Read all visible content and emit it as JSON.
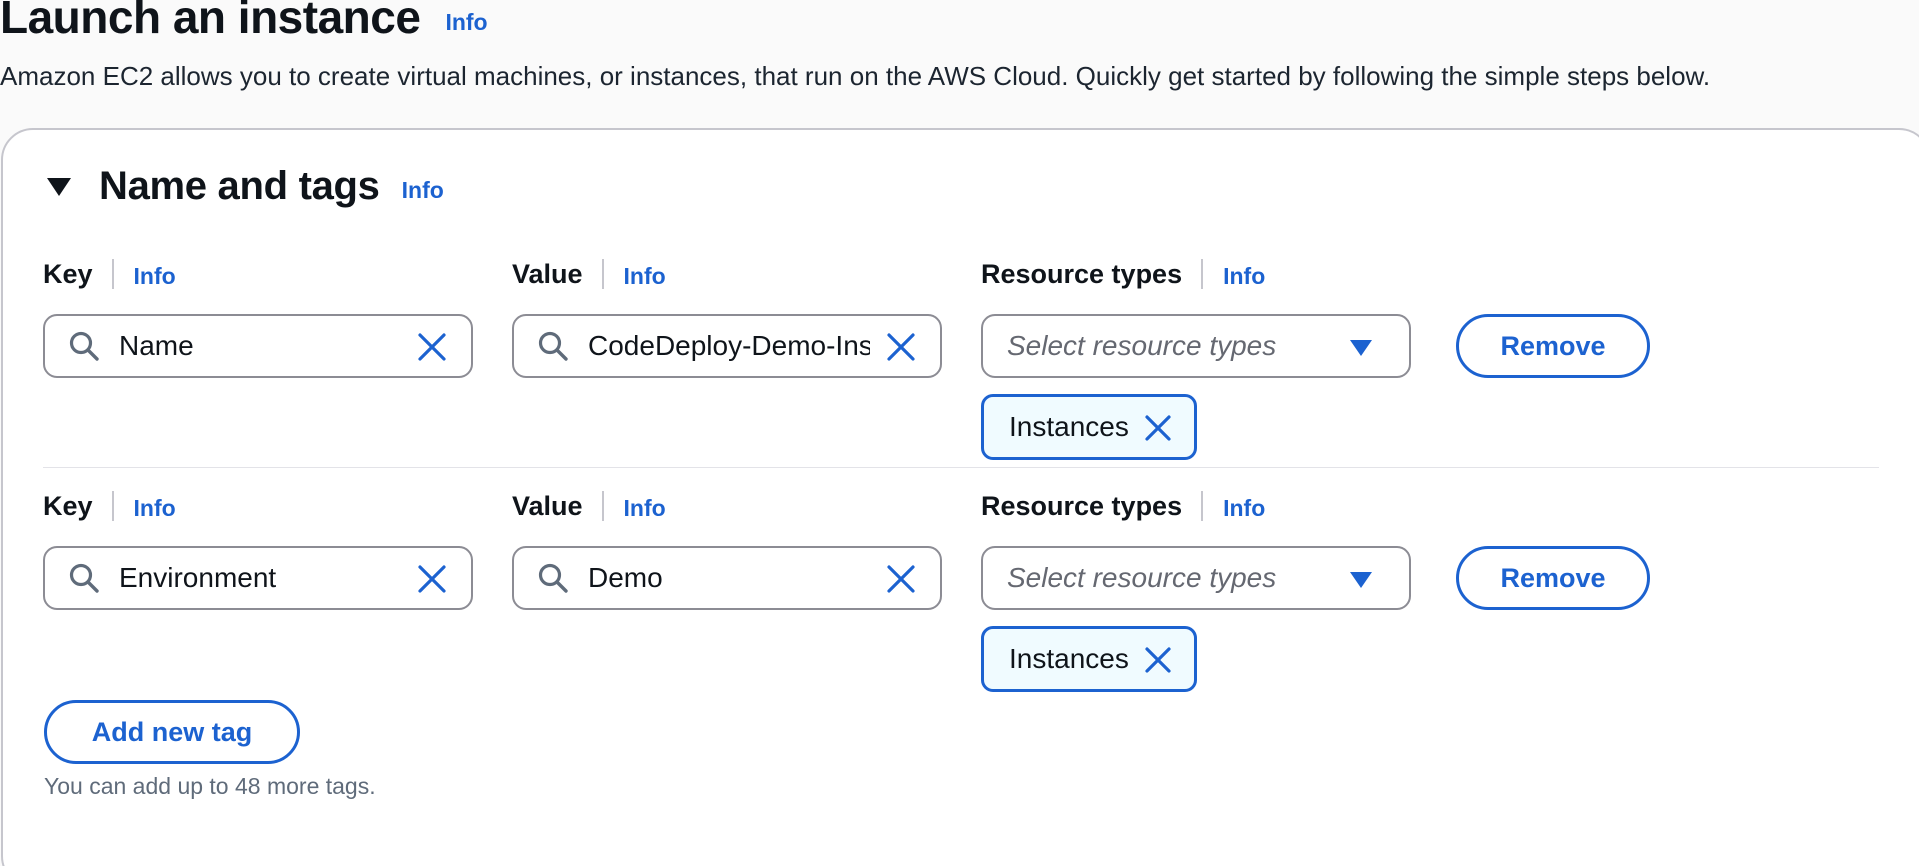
{
  "header": {
    "title": "Launch an instance",
    "info": "Info",
    "description": "Amazon EC2 allows you to create virtual machines, or instances, that run on the AWS Cloud. Quickly get started by following the simple steps below."
  },
  "section": {
    "title": "Name and tags",
    "info": "Info",
    "expanded": true
  },
  "labels": {
    "key": "Key",
    "value": "Value",
    "resource_types": "Resource types",
    "info": "Info",
    "select_placeholder": "Select resource types",
    "remove": "Remove"
  },
  "tags": [
    {
      "key": "Name",
      "value": "CodeDeploy-Demo-Ins",
      "resource_types": [
        "Instances"
      ]
    },
    {
      "key": "Environment",
      "value": "Demo",
      "resource_types": [
        "Instances"
      ]
    }
  ],
  "add_tag": {
    "label": "Add new tag",
    "hint": "You can add up to 48 more tags."
  },
  "colors": {
    "link": "#1c62d0",
    "token_bg": "#f0fbff",
    "border": "#8c8c94"
  },
  "icons": {
    "search": "search-icon",
    "clear": "close-icon",
    "dropdown": "caret-down-icon",
    "expand": "caret-down-icon"
  }
}
